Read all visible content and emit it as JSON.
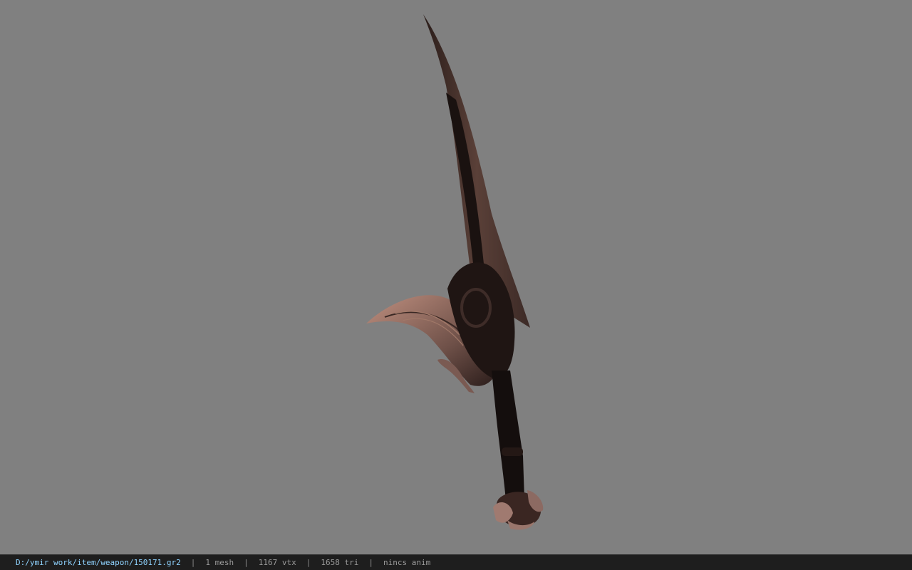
{
  "viewer": {
    "background_color": "#808080",
    "model_icon": "sword-model"
  },
  "status": {
    "file_path": "D:/ymir work/item/weapon/150171.gr2",
    "separator": "|",
    "mesh": "1 mesh",
    "vertices": "1167 vtx",
    "triangles": "1658 tri",
    "anim": "nincs anim",
    "path_color": "#8fd3ff"
  }
}
